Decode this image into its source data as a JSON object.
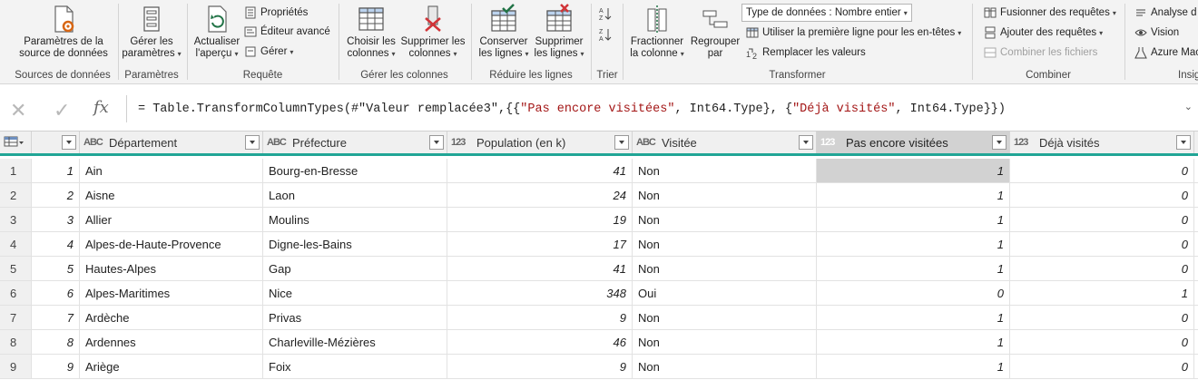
{
  "ribbon": {
    "sources": {
      "btn_line1": "Paramètres de la",
      "btn_line2": "source de données",
      "group": "Sources de données"
    },
    "params": {
      "btn_line1": "Gérer les",
      "btn_line2": "paramètres",
      "group": "Paramètres"
    },
    "requete": {
      "refresh_line1": "Actualiser",
      "refresh_line2": "l'aperçu",
      "properties": "Propriétés",
      "advanced_editor": "Éditeur avancé",
      "manage": "Gérer",
      "group": "Requête"
    },
    "columns": {
      "choose_line1": "Choisir les",
      "choose_line2": "colonnes",
      "remove_line1": "Supprimer les",
      "remove_line2": "colonnes",
      "group": "Gérer les colonnes"
    },
    "rows": {
      "keep_line1": "Conserver",
      "keep_line2": "les lignes",
      "remove_line1": "Supprimer",
      "remove_line2": "les lignes",
      "group": "Réduire les lignes"
    },
    "sort": {
      "group": "Trier"
    },
    "transform": {
      "split_line1": "Fractionner",
      "split_line2": "la colonne",
      "group_by_line1": "Regrouper",
      "group_by_line2": "par",
      "data_type": "Type de données : Nombre entier",
      "first_row_headers": "Utiliser la première ligne pour les en-têtes",
      "replace_values": "Remplacer les valeurs",
      "group": "Transformer"
    },
    "combine": {
      "merge": "Fusionner des requêtes",
      "append": "Ajouter des requêtes",
      "combine_files": "Combiner les fichiers",
      "group": "Combiner"
    },
    "insights": {
      "text_analysis": "Analyse d",
      "vision": "Vision",
      "azure_ml": "Azure Mac",
      "group": "Insig"
    }
  },
  "formula": {
    "prefix": "= Table.TransformColumnTypes(#",
    "step": "\"Valeur remplacée3\"",
    "mid1": ",{{",
    "col1": "\"Pas encore visitées\"",
    "mid2": ", Int64.Type}, {",
    "col2": "\"Déjà visités\"",
    "suffix": ", Int64.Type}})"
  },
  "grid": {
    "type_text": "ABC",
    "type_int": "123",
    "columns": [
      "Département",
      "Préfecture",
      "Population (en k)",
      "Visitée",
      "Pas encore visitées",
      "Déjà visités"
    ],
    "rows": [
      {
        "n": "1",
        "id": "1",
        "dep": "Ain",
        "pref": "Bourg-en-Bresse",
        "pop": "41",
        "vis": "Non",
        "pas": "1",
        "deja": "0"
      },
      {
        "n": "2",
        "id": "2",
        "dep": "Aisne",
        "pref": "Laon",
        "pop": "24",
        "vis": "Non",
        "pas": "1",
        "deja": "0"
      },
      {
        "n": "3",
        "id": "3",
        "dep": "Allier",
        "pref": "Moulins",
        "pop": "19",
        "vis": "Non",
        "pas": "1",
        "deja": "0"
      },
      {
        "n": "4",
        "id": "4",
        "dep": "Alpes-de-Haute-Provence",
        "pref": "Digne-les-Bains",
        "pop": "17",
        "vis": "Non",
        "pas": "1",
        "deja": "0"
      },
      {
        "n": "5",
        "id": "5",
        "dep": "Hautes-Alpes",
        "pref": "Gap",
        "pop": "41",
        "vis": "Non",
        "pas": "1",
        "deja": "0"
      },
      {
        "n": "6",
        "id": "6",
        "dep": "Alpes-Maritimes",
        "pref": "Nice",
        "pop": "348",
        "vis": "Oui",
        "pas": "0",
        "deja": "1"
      },
      {
        "n": "7",
        "id": "7",
        "dep": "Ardèche",
        "pref": "Privas",
        "pop": "9",
        "vis": "Non",
        "pas": "1",
        "deja": "0"
      },
      {
        "n": "8",
        "id": "8",
        "dep": "Ardennes",
        "pref": "Charleville-Mézières",
        "pop": "46",
        "vis": "Non",
        "pas": "1",
        "deja": "0"
      },
      {
        "n": "9",
        "id": "9",
        "dep": "Ariège",
        "pref": "Foix",
        "pop": "9",
        "vis": "Non",
        "pas": "1",
        "deja": "0"
      }
    ]
  },
  "colors": {
    "accent_teal": "#21a596",
    "excel_green": "#217346",
    "remove_red": "#d13438",
    "selected_gray": "#d2d2d2"
  }
}
